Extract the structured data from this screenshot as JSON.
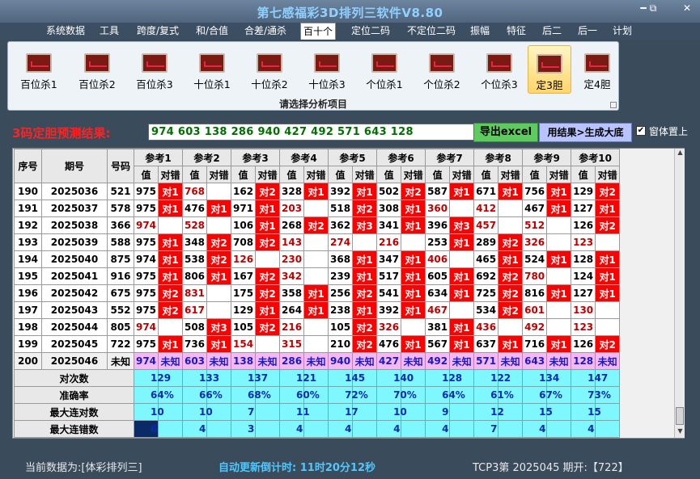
{
  "window": {
    "title": "第七感福彩3D排列三软件V8.80",
    "minimize": "━",
    "restore": "⧉",
    "close": "✕"
  },
  "menu": [
    "系统数据",
    "工具",
    "跨度/复式",
    "和/合值",
    "合差/通杀",
    "百十个",
    "定位二码",
    "不定位二码",
    "振幅",
    "特征",
    "后二",
    "后一",
    "计划"
  ],
  "menu_active": "百十个",
  "ribbon": {
    "buttons": [
      "百位杀1",
      "百位杀2",
      "百位杀3",
      "十位杀1",
      "十位杀2",
      "十位杀3",
      "个位杀1",
      "个位杀2",
      "个位杀3",
      "定3胆",
      "定4胆"
    ],
    "selected": "定3胆",
    "caption": "请选择分析项目"
  },
  "prediction": {
    "label": "3码定胆预测结果:",
    "value": "974 603 138 286 940 427 492 571 643 128",
    "excel_button": "导出excel",
    "generate_button": "用结果>生成大底",
    "checkbox_checked": true,
    "checkbox_label": "窗体置上"
  },
  "grid": {
    "header_top": [
      "序号",
      "期号",
      "号码",
      "参考1",
      "参考2",
      "参考3",
      "参考4",
      "参考5",
      "参考6",
      "参考7",
      "参考8",
      "参考9",
      "参考10"
    ],
    "sub_headers": [
      "值",
      "对错"
    ],
    "rows": [
      {
        "seq": "190",
        "issue": "2025036",
        "num": "521",
        "cells": [
          [
            "975",
            false,
            "对1"
          ],
          [
            "768",
            true,
            ""
          ],
          [
            "162",
            false,
            "对2"
          ],
          [
            "328",
            false,
            "对1"
          ],
          [
            "392",
            false,
            "对1"
          ],
          [
            "502",
            false,
            "对2"
          ],
          [
            "587",
            false,
            "对1"
          ],
          [
            "671",
            false,
            "对1"
          ],
          [
            "756",
            false,
            "对1"
          ],
          [
            "129",
            false,
            "对2"
          ]
        ]
      },
      {
        "seq": "191",
        "issue": "2025037",
        "num": "578",
        "cells": [
          [
            "975",
            false,
            "对1"
          ],
          [
            "476",
            false,
            "对1"
          ],
          [
            "971",
            false,
            "对1"
          ],
          [
            "203",
            true,
            ""
          ],
          [
            "518",
            false,
            "对2"
          ],
          [
            "308",
            false,
            "对1"
          ],
          [
            "360",
            true,
            ""
          ],
          [
            "412",
            true,
            ""
          ],
          [
            "467",
            false,
            "对1"
          ],
          [
            "127",
            false,
            "对1"
          ]
        ]
      },
      {
        "seq": "192",
        "issue": "2025038",
        "num": "366",
        "cells": [
          [
            "974",
            true,
            ""
          ],
          [
            "528",
            true,
            ""
          ],
          [
            "106",
            false,
            "对1"
          ],
          [
            "268",
            false,
            "对2"
          ],
          [
            "362",
            false,
            "对3"
          ],
          [
            "341",
            false,
            "对1"
          ],
          [
            "396",
            false,
            "对3"
          ],
          [
            "457",
            true,
            ""
          ],
          [
            "512",
            true,
            ""
          ],
          [
            "126",
            false,
            "对2"
          ]
        ]
      },
      {
        "seq": "193",
        "issue": "2025039",
        "num": "588",
        "cells": [
          [
            "975",
            false,
            "对1"
          ],
          [
            "348",
            false,
            "对2"
          ],
          [
            "708",
            false,
            "对2"
          ],
          [
            "143",
            true,
            ""
          ],
          [
            "274",
            true,
            ""
          ],
          [
            "216",
            true,
            ""
          ],
          [
            "253",
            false,
            "对1"
          ],
          [
            "289",
            false,
            "对2"
          ],
          [
            "326",
            true,
            ""
          ],
          [
            "123",
            true,
            ""
          ]
        ]
      },
      {
        "seq": "194",
        "issue": "2025040",
        "num": "875",
        "cells": [
          [
            "974",
            false,
            "对1"
          ],
          [
            "538",
            false,
            "对2"
          ],
          [
            "126",
            true,
            ""
          ],
          [
            "230",
            true,
            ""
          ],
          [
            "368",
            false,
            "对1"
          ],
          [
            "347",
            false,
            "对1"
          ],
          [
            "406",
            true,
            ""
          ],
          [
            "465",
            false,
            "对1"
          ],
          [
            "524",
            false,
            "对1"
          ],
          [
            "128",
            false,
            "对1"
          ]
        ]
      },
      {
        "seq": "195",
        "issue": "2025041",
        "num": "916",
        "cells": [
          [
            "975",
            false,
            "对1"
          ],
          [
            "806",
            false,
            "对1"
          ],
          [
            "167",
            false,
            "对2"
          ],
          [
            "342",
            true,
            ""
          ],
          [
            "239",
            false,
            "对1"
          ],
          [
            "517",
            false,
            "对1"
          ],
          [
            "605",
            false,
            "对1"
          ],
          [
            "692",
            false,
            "对2"
          ],
          [
            "780",
            true,
            ""
          ],
          [
            "124",
            false,
            "对1"
          ]
        ]
      },
      {
        "seq": "196",
        "issue": "2025042",
        "num": "675",
        "cells": [
          [
            "975",
            false,
            "对2"
          ],
          [
            "831",
            true,
            ""
          ],
          [
            "175",
            false,
            "对2"
          ],
          [
            "358",
            false,
            "对1"
          ],
          [
            "256",
            false,
            "对2"
          ],
          [
            "541",
            false,
            "对1"
          ],
          [
            "634",
            false,
            "对1"
          ],
          [
            "725",
            false,
            "对2"
          ],
          [
            "816",
            false,
            "对1"
          ],
          [
            "127",
            false,
            "对1"
          ]
        ]
      },
      {
        "seq": "197",
        "issue": "2025043",
        "num": "552",
        "cells": [
          [
            "975",
            false,
            "对2"
          ],
          [
            "617",
            true,
            ""
          ],
          [
            "129",
            false,
            "对1"
          ],
          [
            "264",
            false,
            "对1"
          ],
          [
            "238",
            false,
            "对1"
          ],
          [
            "392",
            false,
            "对1"
          ],
          [
            "467",
            true,
            ""
          ],
          [
            "534",
            false,
            "对2"
          ],
          [
            "601",
            true,
            ""
          ],
          [
            "130",
            true,
            ""
          ]
        ]
      },
      {
        "seq": "198",
        "issue": "2025044",
        "num": "805",
        "cells": [
          [
            "974",
            true,
            ""
          ],
          [
            "508",
            false,
            "对3"
          ],
          [
            "105",
            false,
            "对2"
          ],
          [
            "216",
            true,
            ""
          ],
          [
            "105",
            false,
            "对2"
          ],
          [
            "326",
            true,
            ""
          ],
          [
            "381",
            false,
            "对1"
          ],
          [
            "436",
            true,
            ""
          ],
          [
            "492",
            true,
            ""
          ],
          [
            "123",
            true,
            ""
          ]
        ]
      },
      {
        "seq": "199",
        "issue": "2025045",
        "num": "722",
        "cells": [
          [
            "975",
            false,
            "对1"
          ],
          [
            "736",
            false,
            "对1"
          ],
          [
            "154",
            true,
            ""
          ],
          [
            "315",
            true,
            ""
          ],
          [
            "210",
            false,
            "对2"
          ],
          [
            "476",
            false,
            "对1"
          ],
          [
            "567",
            false,
            "对1"
          ],
          [
            "637",
            false,
            "对1"
          ],
          [
            "716",
            false,
            "对1"
          ],
          [
            "126",
            false,
            "对2"
          ]
        ]
      }
    ],
    "pred_row": {
      "seq": "200",
      "issue": "2025046",
      "num": "未知",
      "values": [
        "974",
        "603",
        "138",
        "286",
        "940",
        "427",
        "492",
        "571",
        "643",
        "128"
      ],
      "status": "未知"
    },
    "stats": [
      {
        "label": "对次数",
        "values": [
          "129",
          "133",
          "137",
          "121",
          "145",
          "140",
          "128",
          "122",
          "134",
          "147"
        ]
      },
      {
        "label": "准确率",
        "values": [
          "64%",
          "66%",
          "68%",
          "60%",
          "72%",
          "70%",
          "64%",
          "61%",
          "67%",
          "73%"
        ]
      },
      {
        "label": "最大连对数",
        "values": [
          "10",
          "10",
          "7",
          "11",
          "17",
          "10",
          "9",
          "12",
          "15",
          "15"
        ]
      },
      {
        "label": "最大连错数",
        "values": [
          "6",
          "4",
          "3",
          "4",
          "4",
          "4",
          "4",
          "7",
          "4",
          "4"
        ]
      }
    ]
  },
  "status": {
    "current_data": "当前数据为:[体彩排列三]",
    "countdown": "自动更新倒计时: 11时20分12秒",
    "last_draw": "TCP3第 2025045 期开:【722】"
  },
  "colors": {
    "hit": "#ff0000",
    "miss_text": "#c00000",
    "pred_row": "#f5b8f5",
    "stats_row": "#7ff7ff",
    "accent": "#4fc7ff"
  }
}
